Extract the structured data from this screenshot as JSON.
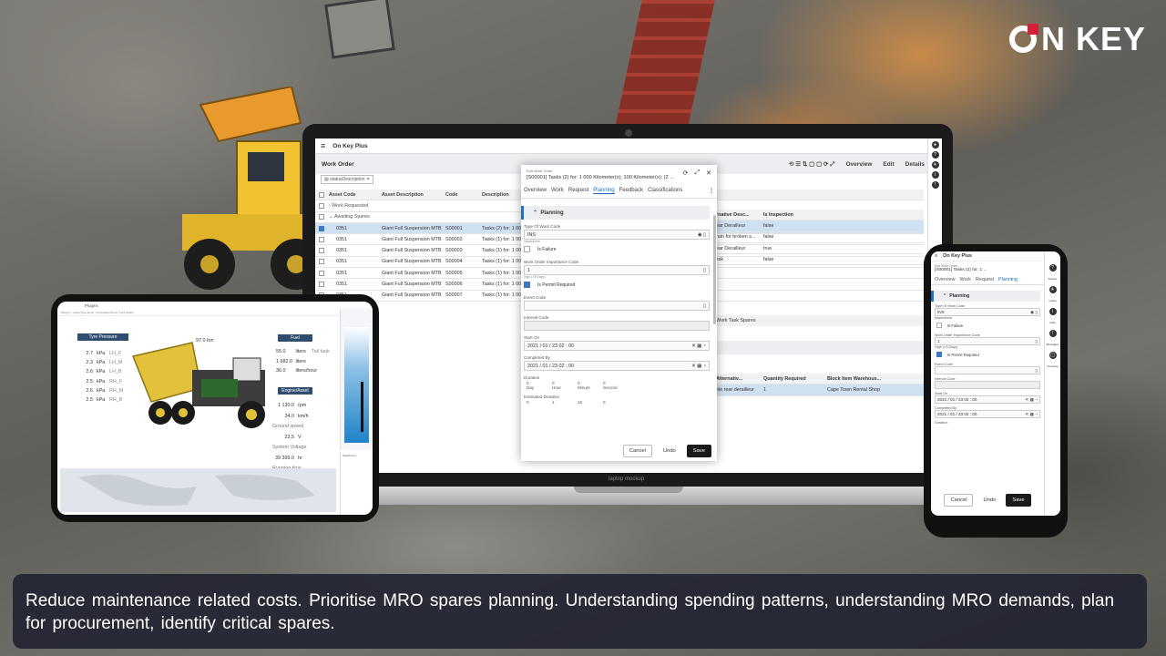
{
  "brand": {
    "logo_text_after_o": "N KEY",
    "logo_accent": "#d3203a"
  },
  "caption": {
    "text": "Reduce maintenance related costs. Prioritise MRO spares planning. Understanding spending patterns, understanding MRO demands, plan for procurement, identify critical spares."
  },
  "laptop": {
    "app_title": "On Key Plus",
    "page_title": "Work Order",
    "actions": [
      "Overview",
      "Edit",
      "Details"
    ],
    "filter_chip": "statusDescription",
    "label_text": "laptop mockup",
    "columns": [
      "Asset Code",
      "Asset Description",
      "Code",
      "Description"
    ],
    "groups": [
      "Work Requested",
      "Awaiting Spares"
    ],
    "rows": [
      {
        "asset": "0351",
        "desc": "Giant Full Suspension MTB",
        "code": "S00001",
        "text": "Tasks (2) for: 1 00"
      },
      {
        "asset": "0351",
        "desc": "Giant Full Suspension MTB",
        "code": "S00002",
        "text": "Tasks (1) for: 1 00"
      },
      {
        "asset": "0351",
        "desc": "Giant Full Suspension MTB",
        "code": "S00003",
        "text": "Tasks (1) for: 1 00"
      },
      {
        "asset": "0351",
        "desc": "Giant Full Suspension MTB",
        "code": "S00004",
        "text": "Tasks (1) for: 1 00"
      },
      {
        "asset": "0351",
        "desc": "Giant Full Suspension MTB",
        "code": "S00005",
        "text": "Tasks (1) for: 1 00"
      },
      {
        "asset": "0351",
        "desc": "Giant Full Suspension MTB",
        "code": "S00006",
        "text": "Tasks (1) for: 1 00"
      },
      {
        "asset": "0351",
        "desc": "Giant Full Suspension MTB",
        "code": "S00007",
        "text": "Tasks (1) for: 1 00"
      }
    ],
    "right_columns": [
      "rnative Desc...",
      "Is Inspection"
    ],
    "right_rows": [
      {
        "a": "ear Derailleur",
        "b": "false"
      },
      {
        "a": "rain for broken s...",
        "b": "false"
      },
      {
        "a": "ear Derailleur",
        "b": "true"
      },
      {
        "a": "ssk",
        "b": "false"
      }
    ],
    "lower_title": "Work Task Spares",
    "lower_columns": [
      "Alternativ...",
      "Quantity Required",
      "Block Item Warehous..."
    ],
    "lower_row": {
      "a": "ole rear derailleur",
      "b": "1",
      "c": "Cape Town Rental Shop"
    }
  },
  "dialog": {
    "title_small": "Edit Work Order",
    "title": "[S00001] Tasks (2) for: 1 000 Kilometer(s); 100 Kilometer(s); (2 ...",
    "tabs": [
      "Overview",
      "Work",
      "Request",
      "Planning",
      "Feedback",
      "Classifications"
    ],
    "active_tab": "Planning",
    "section": "Planning",
    "type_label": "Type Of Work Code",
    "type_value": "INS",
    "type_hint": "Inspections",
    "is_failure": "Is Failure",
    "importance_label": "Work Order Importance Code",
    "importance_value": "1",
    "importance_hint": "High (<3 Days)",
    "is_permit": "Is Permit Required",
    "event_label": "Event Code",
    "interval_label": "Interval Code",
    "start_label": "Start On",
    "start_value": "2021 / 01 / 23  02 : 00",
    "completed_label": "Completed By",
    "completed_value": "2021 / 01 / 23  02 : 00",
    "duration_label": "Duration",
    "duration_units": [
      "Day",
      "Hour",
      "Minute",
      "Second"
    ],
    "duration_values": [
      "0",
      "0",
      "0",
      "0"
    ],
    "est_label": "Estimated Duration",
    "est_values": [
      "0",
      "1",
      "15",
      "0"
    ],
    "cancel": "Cancel",
    "undo": "Undo",
    "save": "Save"
  },
  "tablet": {
    "title": "Plugins",
    "breadcrumb": "Plugins  >  Asset Type Items  >  Articulated Dump Truck Status",
    "tyre_header": "Tyre Pressure",
    "tyres": [
      {
        "v": "2.7",
        "u": "kPa",
        "n": "LH_F"
      },
      {
        "v": "2.3",
        "u": "kPa",
        "n": "LH_M"
      },
      {
        "v": "2.6",
        "u": "kPa",
        "n": "LH_B"
      },
      {
        "v": "2.5",
        "u": "kPa",
        "n": "RH_F"
      },
      {
        "v": "2.6",
        "u": "kPa",
        "n": "RH_M"
      },
      {
        "v": "2.5",
        "u": "kPa",
        "n": "RH_B"
      }
    ],
    "tonnage": "97.0 ton",
    "fuel_header": "Fuel",
    "fuel": [
      {
        "v": "55.0",
        "u": "liters",
        "n": "Tail tank"
      },
      {
        "v": "1 682.0",
        "u": "liters",
        "n": ""
      },
      {
        "v": "36.0",
        "u": "liters/hour",
        "n": ""
      }
    ],
    "engine_header": "Engine/Asset",
    "engine": [
      {
        "v": "1 130.0",
        "u": "rpm",
        "n": ""
      },
      {
        "v": "34.0",
        "u": "km/h",
        "n": "Ground speed"
      },
      {
        "v": "23.5",
        "u": "V",
        "n": "System Voltage"
      },
      {
        "v": "39 399.0",
        "u": "hr",
        "n": "Running time"
      }
    ],
    "side_label": "Dashboard"
  },
  "phone": {
    "app_title": "On Key Plus",
    "title_small": "Edit Work Order",
    "title": "[S00001] Tasks (2) for: 1 ...",
    "tabs": [
      "Overview",
      "Work",
      "Request",
      "Planning"
    ],
    "section": "Planning",
    "type_label": "Type Of Work Code",
    "type_value": "INS",
    "type_hint": "Inspections",
    "is_failure": "Is Failure",
    "importance_label": "Work Order Importance Code",
    "importance_value": "1",
    "importance_hint": "High (<3 Days)",
    "is_permit": "Is Permit Required",
    "event_label": "Event Code",
    "interval_label": "Interval Code",
    "start_label": "Start On",
    "start_value": "2021 / 01 / 23  02 : 00",
    "completed_label": "Completed By",
    "completed_value": "2021 / 01 / 23  02 : 00",
    "duration_label": "Duration",
    "cancel": "Cancel",
    "undo": "Undo",
    "save": "Save",
    "side_items": [
      "Actions",
      "Guide",
      "Help",
      "Messages",
      "Compare"
    ]
  }
}
